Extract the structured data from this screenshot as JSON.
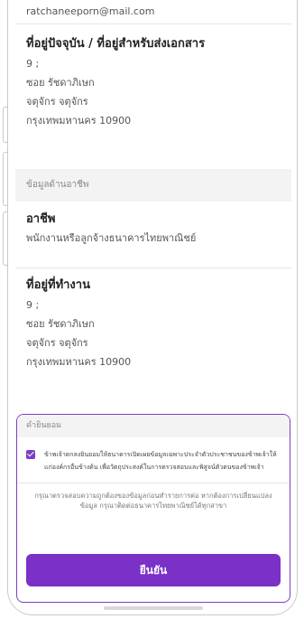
{
  "profile": {
    "email": "ratchaneeporn@mail.com"
  },
  "current_address": {
    "title": "ที่อยู่ปัจจุบัน / ที่อยู่สำหรับส่งเอกสาร",
    "lines": [
      "9 ;",
      "ซอย รัชดาภิเษก",
      "จตุจักร จตุจักร",
      "กรุงเทพมหานคร 10900"
    ]
  },
  "occupation_section": {
    "header": "ข้อมูลด้านอาชีพ",
    "occupation_title": "อาชีพ",
    "occupation_value": "พนักงานหรือลูกจ้างธนาคารไทยพาณิชย์"
  },
  "work_address": {
    "title": "ที่อยู่ที่ทำงาน",
    "lines": [
      "9 ;",
      "ซอย รัชดาภิเษก",
      "จตุจักร จตุจักร",
      "กรุงเทพมหานคร 10900"
    ]
  },
  "consent": {
    "header": "คำยินยอม",
    "checked": true,
    "text": "ข้าพเจ้าตกลงยินยอมให้ธนาคารเปิดเผยข้อมูลเฉพาะประจำตัวประชาชนของข้าพเจ้าให้แก่องค์กรอื่นข้างต้น เพื่อวัตถุประสงค์ในการตรวจสอบและพิสูจน์ตัวตนของข้าพเจ้า",
    "notice": "กรุณาตรวจสอบความถูกต้องของข้อมูลก่อนทำรายการต่อ หากต้องการเปลี่ยนแปลงข้อมูล กรุณาติดต่อธนาคารไทยพาณิชย์ได้ทุกสาขา",
    "confirm_label": "ยืนยัน"
  },
  "colors": {
    "accent": "#7b30c8",
    "border_accent": "#7b3fc4",
    "section_bg": "#f3f3f3"
  }
}
